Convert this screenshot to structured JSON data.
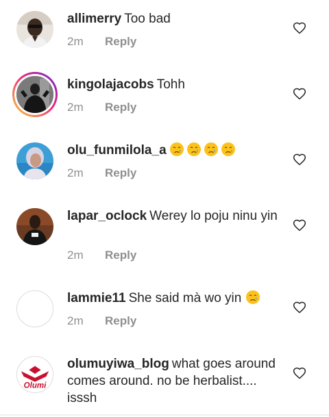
{
  "comments": [
    {
      "username": "allimerry",
      "text": "Too bad",
      "time": "2m",
      "reply": "Reply",
      "avatar": "profile-photo"
    },
    {
      "username": "kingolajacobs",
      "text": "Tohh",
      "time": "2m",
      "reply": "Reply",
      "avatar": "profile-photo-with-story-ring"
    },
    {
      "username": "olu_funmilola_a",
      "text": "",
      "emoji": [
        "crying-face",
        "crying-face",
        "crying-face",
        "crying-face"
      ],
      "time": "2m",
      "reply": "Reply",
      "avatar": "profile-photo"
    },
    {
      "username": "lapar_oclock",
      "text": "Werey lo poju ninu yin",
      "time": "2m",
      "reply": "Reply",
      "avatar": "profile-photo"
    },
    {
      "username": "lammie11",
      "text": "She said mà wo yin",
      "emoji": [
        "crying-face"
      ],
      "time": "2m",
      "reply": "Reply",
      "avatar": "blank"
    },
    {
      "username": "olumuyiwa_blog",
      "text": "what goes around comes around. no be herbalist.... isssh",
      "avatar_text": "Olumi",
      "avatar": "logo"
    }
  ],
  "colors": {
    "text": "#262626",
    "meta": "#8e8e8e",
    "story_ring": [
      "#f9ce34",
      "#ee2a7b",
      "#6228d7"
    ],
    "logo_red": "#c8102e"
  },
  "icons": [
    "heart-outline-icon",
    "crying-face-emoji"
  ]
}
